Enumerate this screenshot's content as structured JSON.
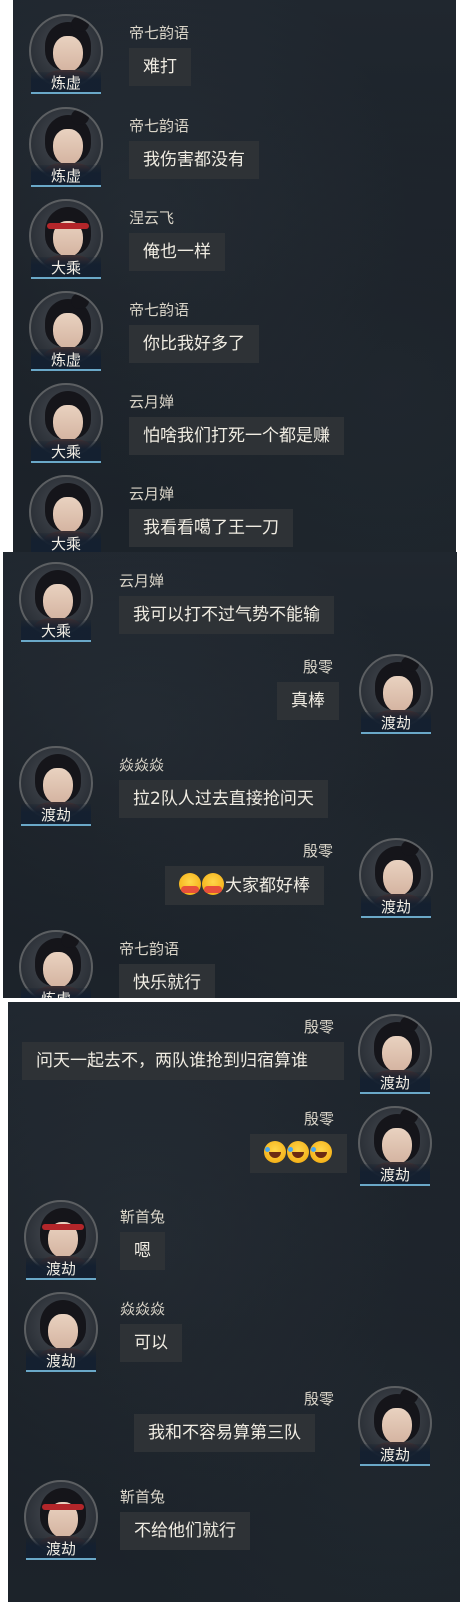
{
  "panels": [
    {
      "messages": [
        {
          "sender": "帝七韵语",
          "rank": "炼虚",
          "text": "难打",
          "side": "left",
          "avatar": "female-ponytail"
        },
        {
          "sender": "帝七韵语",
          "rank": "炼虚",
          "text": "我伤害都没有",
          "side": "left",
          "avatar": "female-ponytail"
        },
        {
          "sender": "涅云飞",
          "rank": "大乘",
          "text": "俺也一样",
          "side": "left",
          "avatar": "male-headband"
        },
        {
          "sender": "帝七韵语",
          "rank": "炼虚",
          "text": "你比我好多了",
          "side": "left",
          "avatar": "female-ponytail"
        },
        {
          "sender": "云月婵",
          "rank": "大乘",
          "text": "怕啥我们打死一个都是赚",
          "side": "left",
          "avatar": "female-long-hair"
        },
        {
          "sender": "云月婵",
          "rank": "大乘",
          "text": "我看看噶了王一刀",
          "side": "left",
          "avatar": "female-long-hair"
        }
      ]
    },
    {
      "messages": [
        {
          "sender": "云月婵",
          "rank": "大乘",
          "text": "我可以打不过气势不能输",
          "side": "left",
          "avatar": "female-long-hair"
        },
        {
          "sender": "殷零",
          "rank": "渡劫",
          "text": "真棒",
          "side": "right",
          "avatar": "female-ponytail"
        },
        {
          "sender": "焱焱焱",
          "rank": "渡劫",
          "text": "拉2队人过去直接抢问天",
          "side": "left",
          "avatar": "female-long-hair"
        },
        {
          "sender": "殷零",
          "rank": "渡劫",
          "text": "大家都好棒",
          "side": "right",
          "avatar": "female-ponytail",
          "emojis": [
            "smiling-hug-emoji",
            "smiling-hug-emoji"
          ]
        },
        {
          "sender": "帝七韵语",
          "rank": "炼虚",
          "text": "快乐就行",
          "side": "left",
          "avatar": "female-ponytail"
        }
      ]
    },
    {
      "messages": [
        {
          "sender": "殷零",
          "rank": "渡劫",
          "text": "问天一起去不，两队谁抢到归宿算谁",
          "side": "right",
          "avatar": "female-ponytail"
        },
        {
          "sender": "殷零",
          "rank": "渡劫",
          "text": "",
          "side": "right",
          "avatar": "female-ponytail",
          "emojis": [
            "rolling-laugh-emoji",
            "rolling-laugh-emoji",
            "rolling-laugh-emoji"
          ]
        },
        {
          "sender": "靳首兔",
          "rank": "渡劫",
          "text": "嗯",
          "side": "left",
          "avatar": "male-headband"
        },
        {
          "sender": "焱焱焱",
          "rank": "渡劫",
          "text": "可以",
          "side": "left",
          "avatar": "female-long-hair"
        },
        {
          "sender": "殷零",
          "rank": "渡劫",
          "text": "我和不容易算第三队",
          "side": "right",
          "avatar": "female-ponytail"
        },
        {
          "sender": "靳首兔",
          "rank": "渡劫",
          "text": "不给他们就行",
          "side": "left",
          "avatar": "male-headband"
        }
      ]
    }
  ]
}
